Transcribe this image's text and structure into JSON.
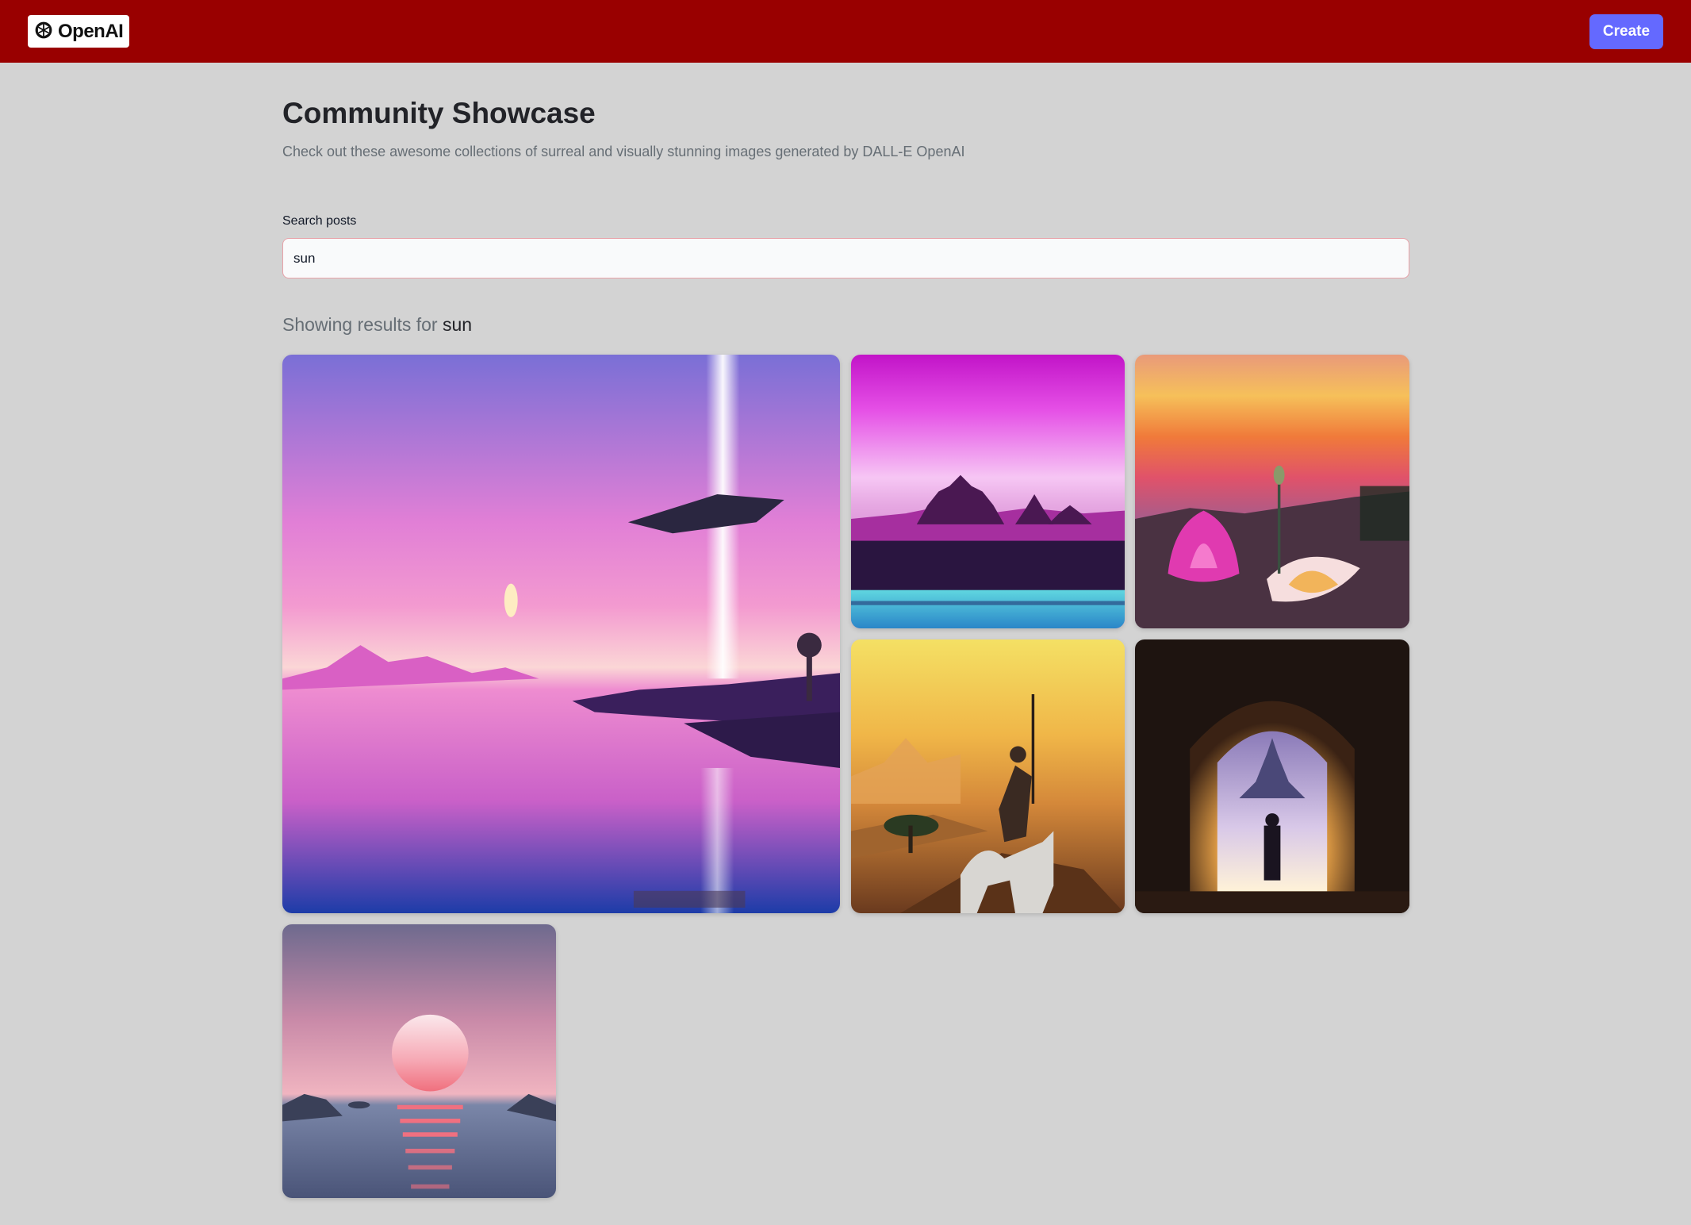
{
  "header": {
    "logo_text": "OpenAI",
    "logo_icon": "openai-knot-icon",
    "create_label": "Create",
    "bar_color": "#990000",
    "button_color": "#6469ff"
  },
  "main": {
    "title": "Community Showcase",
    "subtitle": "Check out these awesome collections of surreal and visually stunning images generated by DALL-E OpenAI"
  },
  "search": {
    "label": "Search posts",
    "value": "sun"
  },
  "results": {
    "prefix": "Showing results for ",
    "query": "sun"
  }
}
